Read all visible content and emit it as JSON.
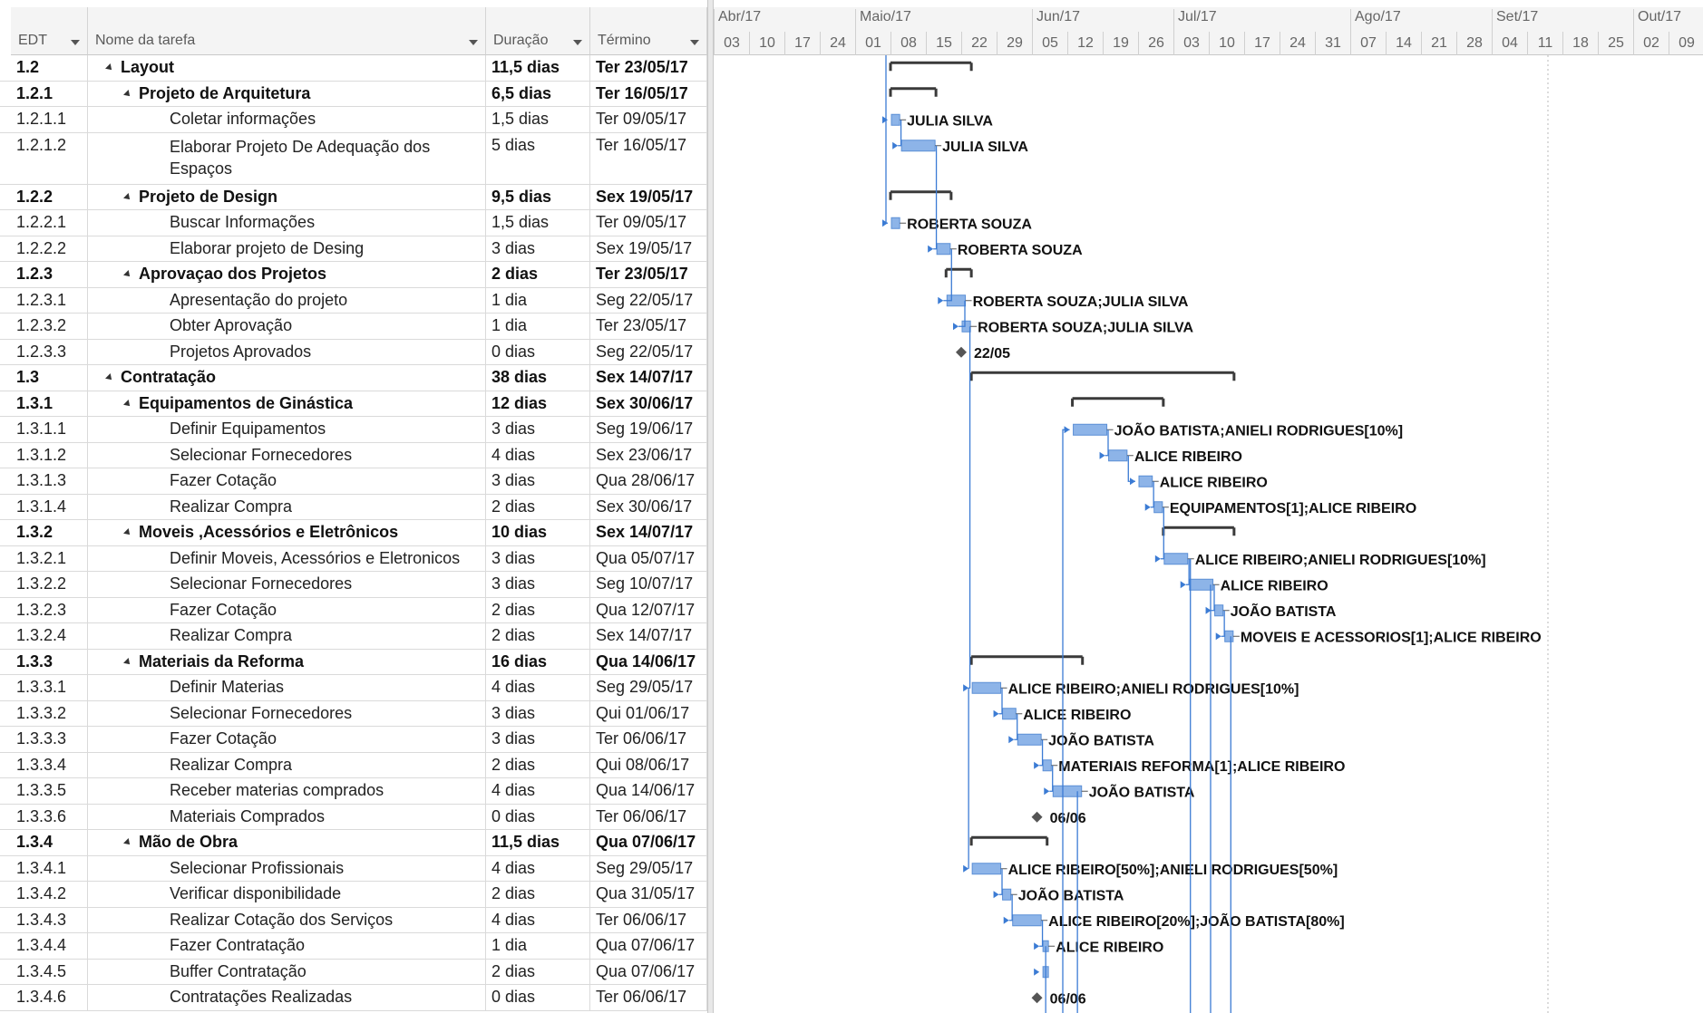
{
  "columns": {
    "edt": "EDT",
    "name": "Nome da tarefa",
    "duration": "Duração",
    "end": "Término"
  },
  "timescale": {
    "months": [
      "Abr/17",
      "Maio/17",
      "Jun/17",
      "Jul/17",
      "Ago/17",
      "Set/17",
      "Out/17"
    ],
    "days": [
      "03",
      "10",
      "17",
      "24",
      "01",
      "08",
      "15",
      "22",
      "29",
      "05",
      "12",
      "19",
      "26",
      "03",
      "10",
      "17",
      "24",
      "31",
      "07",
      "14",
      "21",
      "28",
      "04",
      "11",
      "18",
      "25",
      "02",
      "09"
    ]
  },
  "tasks": [
    {
      "edt": "1.2",
      "name": "Layout",
      "duration": "11,5 dias",
      "end": "Ter 23/05/17",
      "level": 1,
      "summary": true,
      "label": ""
    },
    {
      "edt": "1.2.1",
      "name": "Projeto de Arquitetura",
      "duration": "6,5 dias",
      "end": "Ter 16/05/17",
      "level": 2,
      "summary": true,
      "label": ""
    },
    {
      "edt": "1.2.1.1",
      "name": "Coletar informações",
      "duration": "1,5 dias",
      "end": "Ter 09/05/17",
      "level": 3,
      "summary": false,
      "label": "JULIA SILVA"
    },
    {
      "edt": "1.2.1.2",
      "name": "Elaborar Projeto De Adequação dos Espaços",
      "duration": "5 dias",
      "end": "Ter 16/05/17",
      "level": 3,
      "summary": false,
      "label": "JULIA SILVA",
      "tall": true
    },
    {
      "edt": "1.2.2",
      "name": "Projeto de Design",
      "duration": "9,5 dias",
      "end": "Sex 19/05/17",
      "level": 2,
      "summary": true,
      "label": ""
    },
    {
      "edt": "1.2.2.1",
      "name": "Buscar Informações",
      "duration": "1,5 dias",
      "end": "Ter 09/05/17",
      "level": 3,
      "summary": false,
      "label": "ROBERTA SOUZA"
    },
    {
      "edt": "1.2.2.2",
      "name": "Elaborar projeto de Desing",
      "duration": "3 dias",
      "end": "Sex 19/05/17",
      "level": 3,
      "summary": false,
      "label": "ROBERTA SOUZA"
    },
    {
      "edt": "1.2.3",
      "name": "Aprovaçao dos Projetos",
      "duration": "2 dias",
      "end": "Ter 23/05/17",
      "level": 2,
      "summary": true,
      "label": ""
    },
    {
      "edt": "1.2.3.1",
      "name": "Apresentação do projeto",
      "duration": "1 dia",
      "end": "Seg 22/05/17",
      "level": 3,
      "summary": false,
      "label": "ROBERTA SOUZA;JULIA SILVA"
    },
    {
      "edt": "1.2.3.2",
      "name": "Obter Aprovação",
      "duration": "1 dia",
      "end": "Ter 23/05/17",
      "level": 3,
      "summary": false,
      "label": "ROBERTA SOUZA;JULIA SILVA"
    },
    {
      "edt": "1.2.3.3",
      "name": "Projetos Aprovados",
      "duration": "0 dias",
      "end": "Seg 22/05/17",
      "level": 3,
      "summary": false,
      "milestone": true,
      "label": "22/05"
    },
    {
      "edt": "1.3",
      "name": "Contratação",
      "duration": "38 dias",
      "end": "Sex 14/07/17",
      "level": 1,
      "summary": true,
      "label": ""
    },
    {
      "edt": "1.3.1",
      "name": "Equipamentos de Ginástica",
      "duration": "12 dias",
      "end": "Sex 30/06/17",
      "level": 2,
      "summary": true,
      "label": ""
    },
    {
      "edt": "1.3.1.1",
      "name": "Definir Equipamentos",
      "duration": "3 dias",
      "end": "Seg 19/06/17",
      "level": 3,
      "summary": false,
      "label": "JOÃO BATISTA;ANIELI RODRIGUES[10%]"
    },
    {
      "edt": "1.3.1.2",
      "name": "Selecionar Fornecedores",
      "duration": "4 dias",
      "end": "Sex 23/06/17",
      "level": 3,
      "summary": false,
      "label": "ALICE RIBEIRO"
    },
    {
      "edt": "1.3.1.3",
      "name": "Fazer Cotação",
      "duration": "3 dias",
      "end": "Qua 28/06/17",
      "level": 3,
      "summary": false,
      "label": "ALICE RIBEIRO"
    },
    {
      "edt": "1.3.1.4",
      "name": "Realizar Compra",
      "duration": "2 dias",
      "end": "Sex 30/06/17",
      "level": 3,
      "summary": false,
      "label": "EQUIPAMENTOS[1];ALICE RIBEIRO"
    },
    {
      "edt": "1.3.2",
      "name": "Moveis ,Acessórios e Eletrônicos",
      "duration": "10 dias",
      "end": "Sex 14/07/17",
      "level": 2,
      "summary": true,
      "label": ""
    },
    {
      "edt": "1.3.2.1",
      "name": "Definir Moveis, Acessórios e Eletronicos",
      "duration": "3 dias",
      "end": "Qua 05/07/17",
      "level": 3,
      "summary": false,
      "label": "ALICE RIBEIRO;ANIELI RODRIGUES[10%]"
    },
    {
      "edt": "1.3.2.2",
      "name": "Selecionar Fornecedores",
      "duration": "3 dias",
      "end": "Seg 10/07/17",
      "level": 3,
      "summary": false,
      "label": "ALICE RIBEIRO"
    },
    {
      "edt": "1.3.2.3",
      "name": "Fazer Cotação",
      "duration": "2 dias",
      "end": "Qua 12/07/17",
      "level": 3,
      "summary": false,
      "label": "JOÃO BATISTA"
    },
    {
      "edt": "1.3.2.4",
      "name": "Realizar Compra",
      "duration": "2 dias",
      "end": "Sex 14/07/17",
      "level": 3,
      "summary": false,
      "label": "MOVEIS E ACESSORIOS[1];ALICE RIBEIRO"
    },
    {
      "edt": "1.3.3",
      "name": "Materiais da Reforma",
      "duration": "16 dias",
      "end": "Qua 14/06/17",
      "level": 2,
      "summary": true,
      "label": ""
    },
    {
      "edt": "1.3.3.1",
      "name": "Definir Materias",
      "duration": "4 dias",
      "end": "Seg 29/05/17",
      "level": 3,
      "summary": false,
      "label": "ALICE RIBEIRO;ANIELI RODRIGUES[10%]"
    },
    {
      "edt": "1.3.3.2",
      "name": "Selecionar Fornecedores",
      "duration": "3 dias",
      "end": "Qui 01/06/17",
      "level": 3,
      "summary": false,
      "label": "ALICE RIBEIRO"
    },
    {
      "edt": "1.3.3.3",
      "name": "Fazer Cotação",
      "duration": "3 dias",
      "end": "Ter 06/06/17",
      "level": 3,
      "summary": false,
      "label": "JOÃO BATISTA"
    },
    {
      "edt": "1.3.3.4",
      "name": "Realizar Compra",
      "duration": "2 dias",
      "end": "Qui 08/06/17",
      "level": 3,
      "summary": false,
      "label": "MATERIAIS REFORMA[1];ALICE RIBEIRO"
    },
    {
      "edt": "1.3.3.5",
      "name": "Receber materias comprados",
      "duration": "4 dias",
      "end": "Qua 14/06/17",
      "level": 3,
      "summary": false,
      "label": "JOÃO BATISTA"
    },
    {
      "edt": "1.3.3.6",
      "name": "Materiais Comprados",
      "duration": "0 dias",
      "end": "Ter 06/06/17",
      "level": 3,
      "summary": false,
      "milestone": true,
      "label": "06/06"
    },
    {
      "edt": "1.3.4",
      "name": "Mão de Obra",
      "duration": "11,5 dias",
      "end": "Qua 07/06/17",
      "level": 2,
      "summary": true,
      "label": ""
    },
    {
      "edt": "1.3.4.1",
      "name": "Selecionar Profissionais",
      "duration": "4 dias",
      "end": "Seg 29/05/17",
      "level": 3,
      "summary": false,
      "label": "ALICE RIBEIRO[50%];ANIELI RODRIGUES[50%]"
    },
    {
      "edt": "1.3.4.2",
      "name": "Verificar disponibilidade",
      "duration": "2 dias",
      "end": "Qua 31/05/17",
      "level": 3,
      "summary": false,
      "label": "JOÃO BATISTA"
    },
    {
      "edt": "1.3.4.3",
      "name": "Realizar Cotação dos Serviços",
      "duration": "4 dias",
      "end": "Ter 06/06/17",
      "level": 3,
      "summary": false,
      "label": "ALICE RIBEIRO[20%];JOÃO BATISTA[80%]"
    },
    {
      "edt": "1.3.4.4",
      "name": "Fazer Contratação",
      "duration": "1 dia",
      "end": "Qua 07/06/17",
      "level": 3,
      "summary": false,
      "label": "ALICE RIBEIRO"
    },
    {
      "edt": "1.3.4.5",
      "name": "Buffer Contratação",
      "duration": "2 dias",
      "end": "Qua 07/06/17",
      "level": 3,
      "summary": false,
      "label": ""
    },
    {
      "edt": "1.3.4.6",
      "name": "Contratações Realizadas",
      "duration": "0 dias",
      "end": "Ter 06/06/17",
      "level": 3,
      "summary": false,
      "milestone": true,
      "label": "06/06"
    }
  ],
  "colors": {
    "bar": "#8db4e8",
    "bar_border": "#5b8fd6",
    "link": "#3b7bd4",
    "summary": "#3a3a3a",
    "milestone": "#555555"
  }
}
